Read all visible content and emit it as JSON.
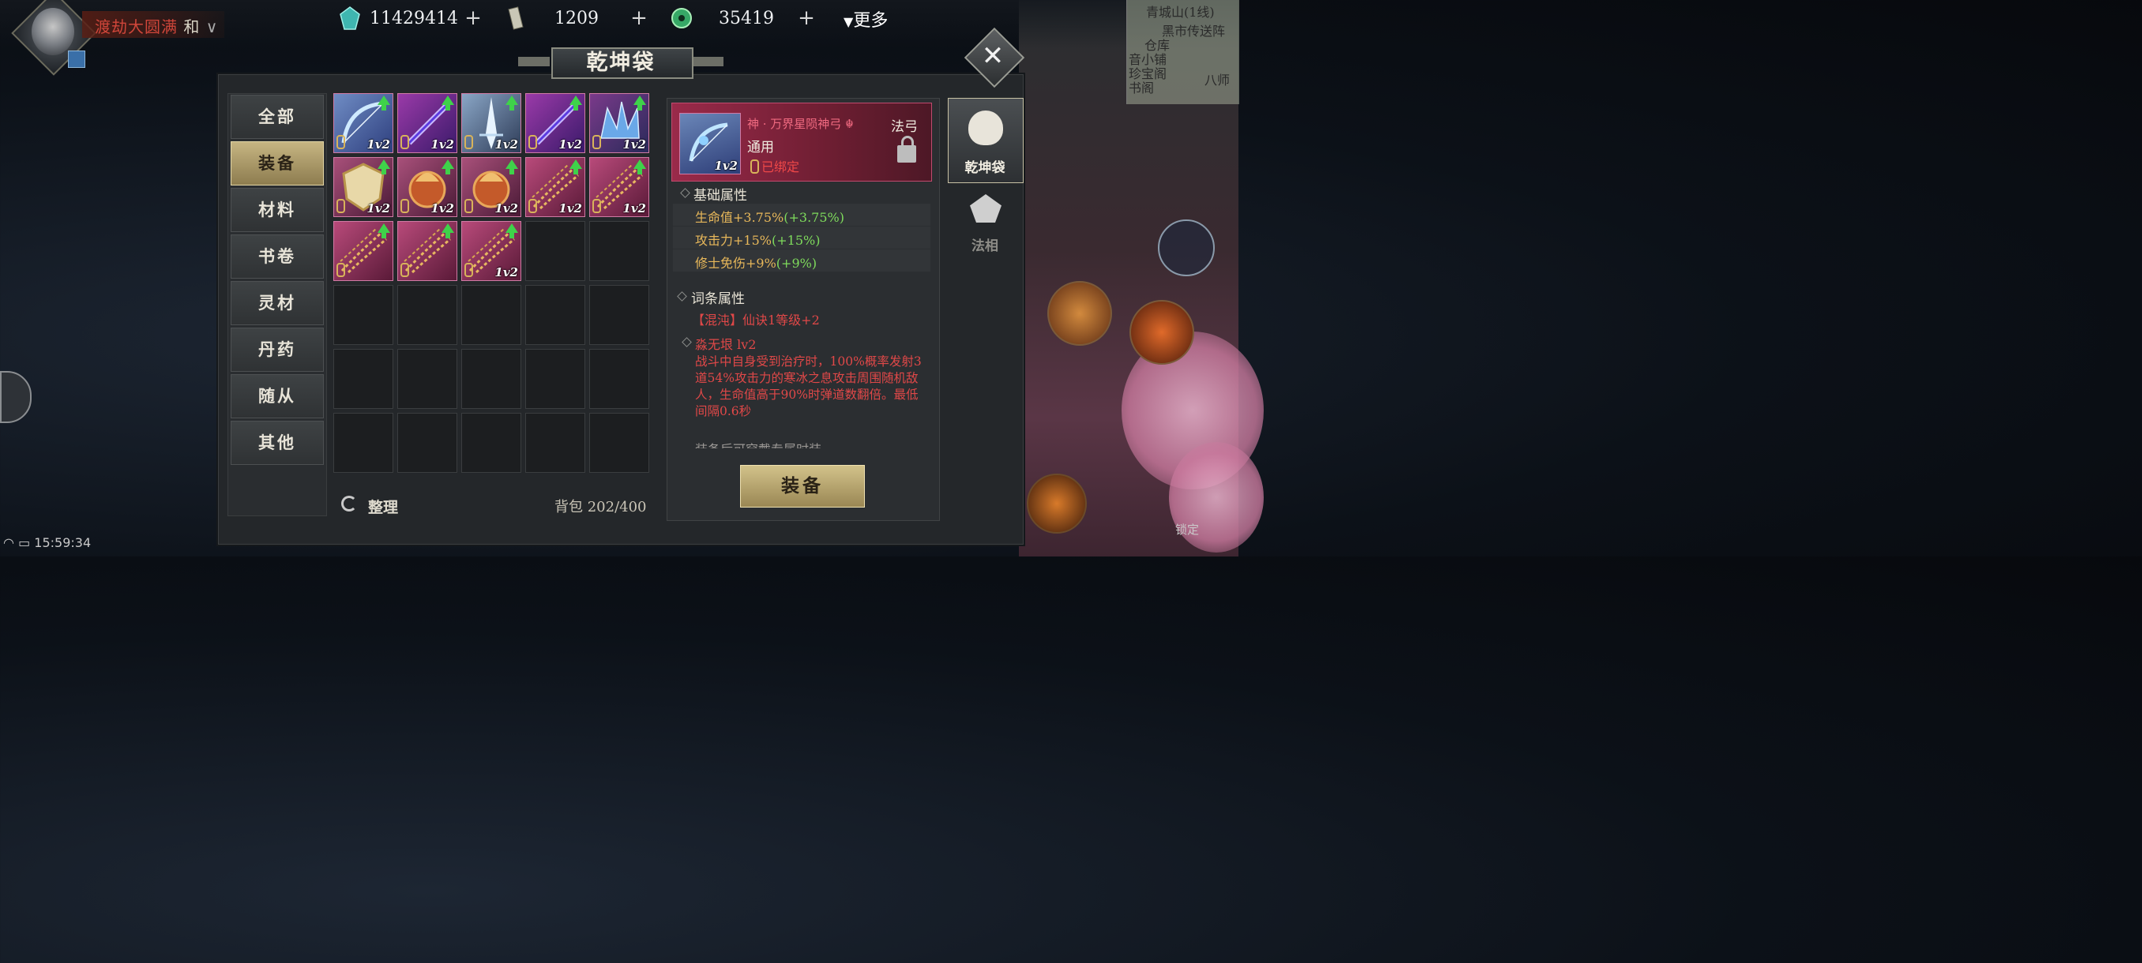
{
  "colors": {
    "accent_gold": "#c6b582",
    "rarity_pink": "#d07aa4",
    "red_text": "#e04848",
    "attr_gold": "#e8b85a",
    "attr_green": "#7fdc5c"
  },
  "player": {
    "realm": "渡劫大圆满",
    "mode": "和"
  },
  "currency": [
    {
      "icon": "jade-crystal-icon",
      "value": "11429414"
    },
    {
      "icon": "talisman-icon",
      "value": "1209"
    },
    {
      "icon": "jade-coin-icon",
      "value": "35419"
    }
  ],
  "more_label": "更多",
  "minimap": {
    "line": "青城山(1线)",
    "labels": [
      "黑市传送阵",
      "仓库",
      "音小铺",
      "珍宝阁",
      "书阁",
      "八师"
    ]
  },
  "panel_title": "乾坤袋",
  "categories": [
    "全部",
    "装备",
    "材料",
    "书卷",
    "灵材",
    "丹药",
    "随从",
    "其他"
  ],
  "active_category": "装备",
  "items": [
    {
      "icon": "frost-bow-icon",
      "level": "1v2",
      "upgrade": true,
      "bound": true
    },
    {
      "icon": "violet-sword-icon",
      "level": "1v2",
      "upgrade": true,
      "bound": true
    },
    {
      "icon": "ice-greatsword-icon",
      "level": "1v2",
      "upgrade": true,
      "bound": true
    },
    {
      "icon": "violet-sword-icon",
      "level": "1v2",
      "upgrade": true,
      "bound": true
    },
    {
      "icon": "azure-crown-icon",
      "level": "1v2",
      "upgrade": true,
      "bound": true
    },
    {
      "icon": "gold-shield-icon",
      "level": "1v2",
      "upgrade": true,
      "bound": true
    },
    {
      "icon": "flame-cauldron-icon",
      "level": "1v2",
      "upgrade": true,
      "bound": true
    },
    {
      "icon": "flame-cauldron-icon",
      "level": "1v2",
      "upgrade": true,
      "bound": true
    },
    {
      "icon": "golden-chain-whip-icon",
      "level": "1v2",
      "upgrade": true,
      "bound": true
    },
    {
      "icon": "golden-chain-whip-icon",
      "level": "1v2",
      "upgrade": true,
      "bound": true
    },
    {
      "icon": "golden-chain-whip-icon",
      "level": "",
      "upgrade": true,
      "bound": true
    },
    {
      "icon": "golden-chain-whip-icon",
      "level": "",
      "upgrade": true,
      "bound": true
    },
    {
      "icon": "golden-chain-whip-icon",
      "level": "1v2",
      "upgrade": true,
      "bound": true
    }
  ],
  "sort_label": "整理",
  "bag_capacity": "背包 202/400",
  "detail": {
    "name": "神 · 万界星陨神弓",
    "type": "法弓",
    "usage": "通用",
    "level": "1v2",
    "bound": "已绑定",
    "base_title": "基础属性",
    "base_attrs": [
      {
        "label": "生命值+3.75%",
        "extra": "(+3.75%)"
      },
      {
        "label": "攻击力+15%",
        "extra": "(+15%)"
      },
      {
        "label": "修士免伤+9%",
        "extra": "(+9%)"
      }
    ],
    "affix_title": "词条属性",
    "affix_line": "【混沌】仙诀1等级+2",
    "skill_name": "淼无垠 lv2",
    "skill_desc": "战斗中自身受到治疗时，100%概率发射3道54%攻击力的寒冰之息攻击周围随机敌人，生命值高于90%时弹道数翻倍。最低间隔0.6秒",
    "faded_line": "装备后可穿戴专属时装"
  },
  "equip_label": "装备",
  "side_tabs": [
    {
      "label": "乾坤袋",
      "icon": "pouch-icon"
    },
    {
      "label": "法相",
      "icon": "dharma-avatar-icon"
    }
  ],
  "status": {
    "time": "15:59:34"
  },
  "hud_lock_label": "锁定"
}
